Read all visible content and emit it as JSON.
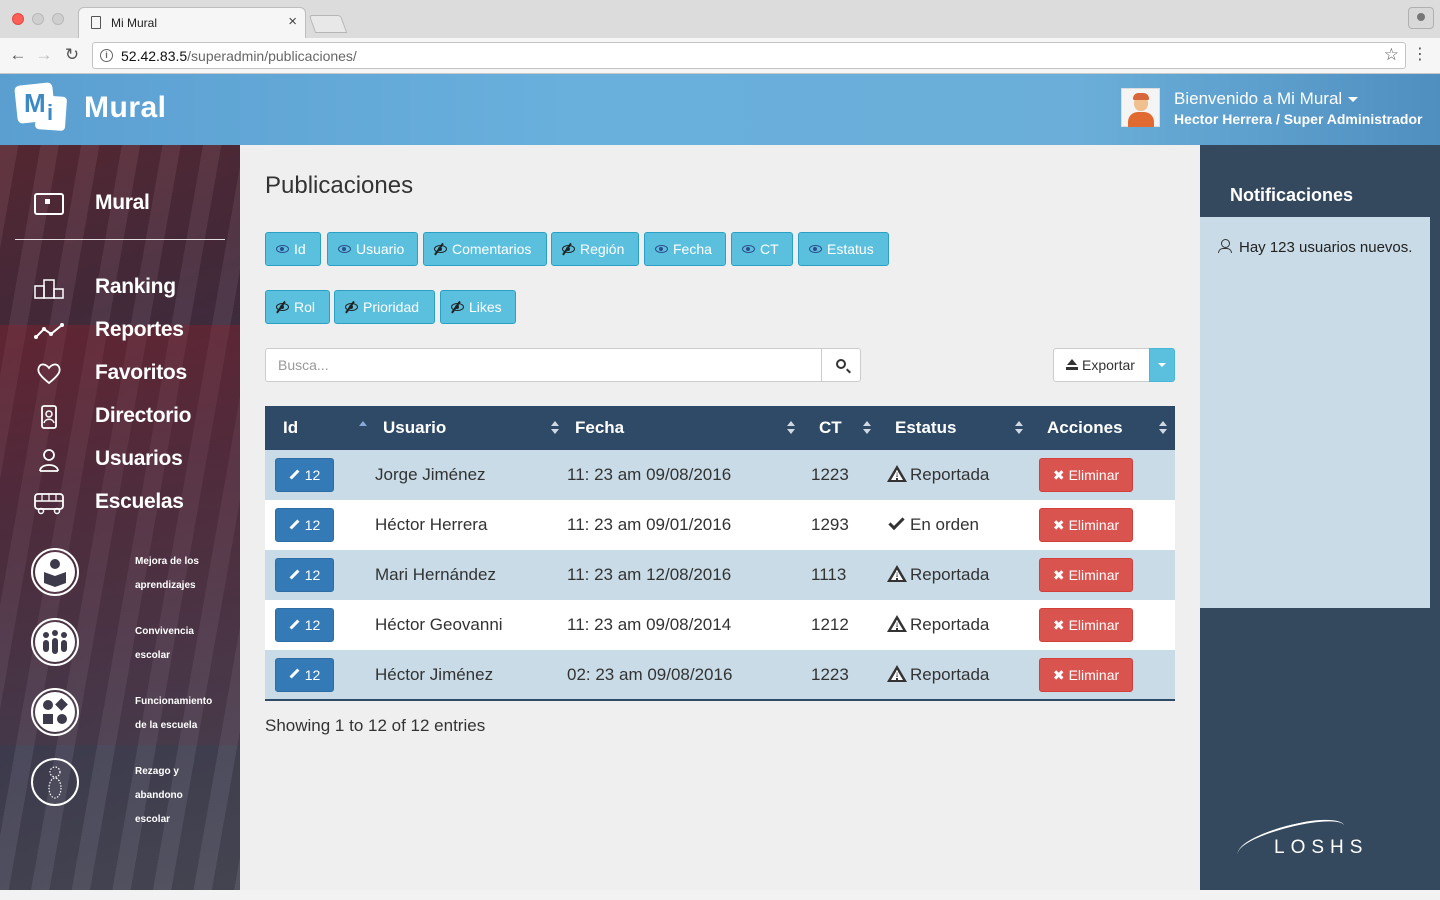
{
  "browser": {
    "tab_title": "Mi Mural",
    "url_host": "52.42.83.5",
    "url_path": "/superadmin/publicaciones/"
  },
  "header": {
    "logo_m": "M",
    "logo_i": "i",
    "logo_word": "Mural",
    "welcome": "Bienvenido a Mi Mural",
    "user_role": "Hector Herrera / Super Administrador"
  },
  "sidebar": {
    "top": {
      "label": "Mural",
      "icon": "mural-icon"
    },
    "items": [
      {
        "label": "Ranking",
        "icon": "ranking-podium-icon"
      },
      {
        "label": "Reportes",
        "icon": "reports-line-icon"
      },
      {
        "label": "Favoritos",
        "icon": "heart-icon"
      },
      {
        "label": "Directorio",
        "icon": "directory-contact-icon"
      },
      {
        "label": "Usuarios",
        "icon": "users-person-icon"
      },
      {
        "label": "Escuelas",
        "icon": "school-bus-icon"
      }
    ],
    "circles": [
      {
        "line1": "Mejora de los",
        "line2": "aprendizajes",
        "icon": "book-reader-icon"
      },
      {
        "line1": "Convivencia",
        "line2": "escolar",
        "icon": "group-people-icon"
      },
      {
        "line1": "Funcionamiento",
        "line2": "de la escuela",
        "icon": "shapes-icon"
      },
      {
        "line1": "Rezago y",
        "line2": "abandono",
        "line3": "escolar",
        "icon": "dotted-figure-icon"
      }
    ]
  },
  "main": {
    "title": "Publicaciones",
    "column_toggles_row1": [
      {
        "label": "Id",
        "visible": true
      },
      {
        "label": "Usuario",
        "visible": true
      },
      {
        "label": "Comentarios",
        "visible": false
      },
      {
        "label": "Región",
        "visible": false
      },
      {
        "label": "Fecha",
        "visible": true
      },
      {
        "label": "CT",
        "visible": true
      },
      {
        "label": "Estatus",
        "visible": true
      }
    ],
    "column_toggles_row2": [
      {
        "label": "Rol",
        "visible": false
      },
      {
        "label": "Prioridad",
        "visible": false
      },
      {
        "label": "Likes",
        "visible": false
      }
    ],
    "search": {
      "placeholder": "Busca...",
      "value": ""
    },
    "export_label": "Exportar",
    "table": {
      "headers": [
        "Id",
        "Usuario",
        "Fecha",
        "CT",
        "Estatus",
        "Acciones"
      ],
      "rows": [
        {
          "id": "12",
          "usuario": "Jorge Jiménez",
          "fecha": "11: 23 am 09/08/2016",
          "ct": "1223",
          "estatus": "Reportada",
          "status_type": "warning"
        },
        {
          "id": "12",
          "usuario": "Héctor Herrera",
          "fecha": "11: 23 am 09/01/2016",
          "ct": "1293",
          "estatus": "En orden",
          "status_type": "ok"
        },
        {
          "id": "12",
          "usuario": "Mari Hernández",
          "fecha": "11: 23 am 12/08/2016",
          "ct": "1113",
          "estatus": "Reportada",
          "status_type": "warning"
        },
        {
          "id": "12",
          "usuario": "Héctor Geovanni",
          "fecha": "11: 23 am 09/08/2014",
          "ct": "1212",
          "estatus": "Reportada",
          "status_type": "warning"
        },
        {
          "id": "12",
          "usuario": "Héctor Jiménez",
          "fecha": "02: 23 am 09/08/2016",
          "ct": "1223",
          "estatus": "Reportada",
          "status_type": "warning"
        }
      ],
      "delete_label": "Eliminar",
      "footer": "Showing 1 to 12 of 12 entries"
    }
  },
  "notifications": {
    "title": "Notificaciones",
    "items": [
      {
        "text": "Hay 123 usuarios nuevos."
      }
    ],
    "brand": "LOSHS"
  },
  "colors": {
    "header_blue": "#6ab0dd",
    "table_header": "#2f4a66",
    "row_alt": "#c8dbe6",
    "toggle_info": "#5bc0de",
    "id_primary": "#337ab7",
    "delete_danger": "#d9534f",
    "notif_bg": "#34495e"
  }
}
